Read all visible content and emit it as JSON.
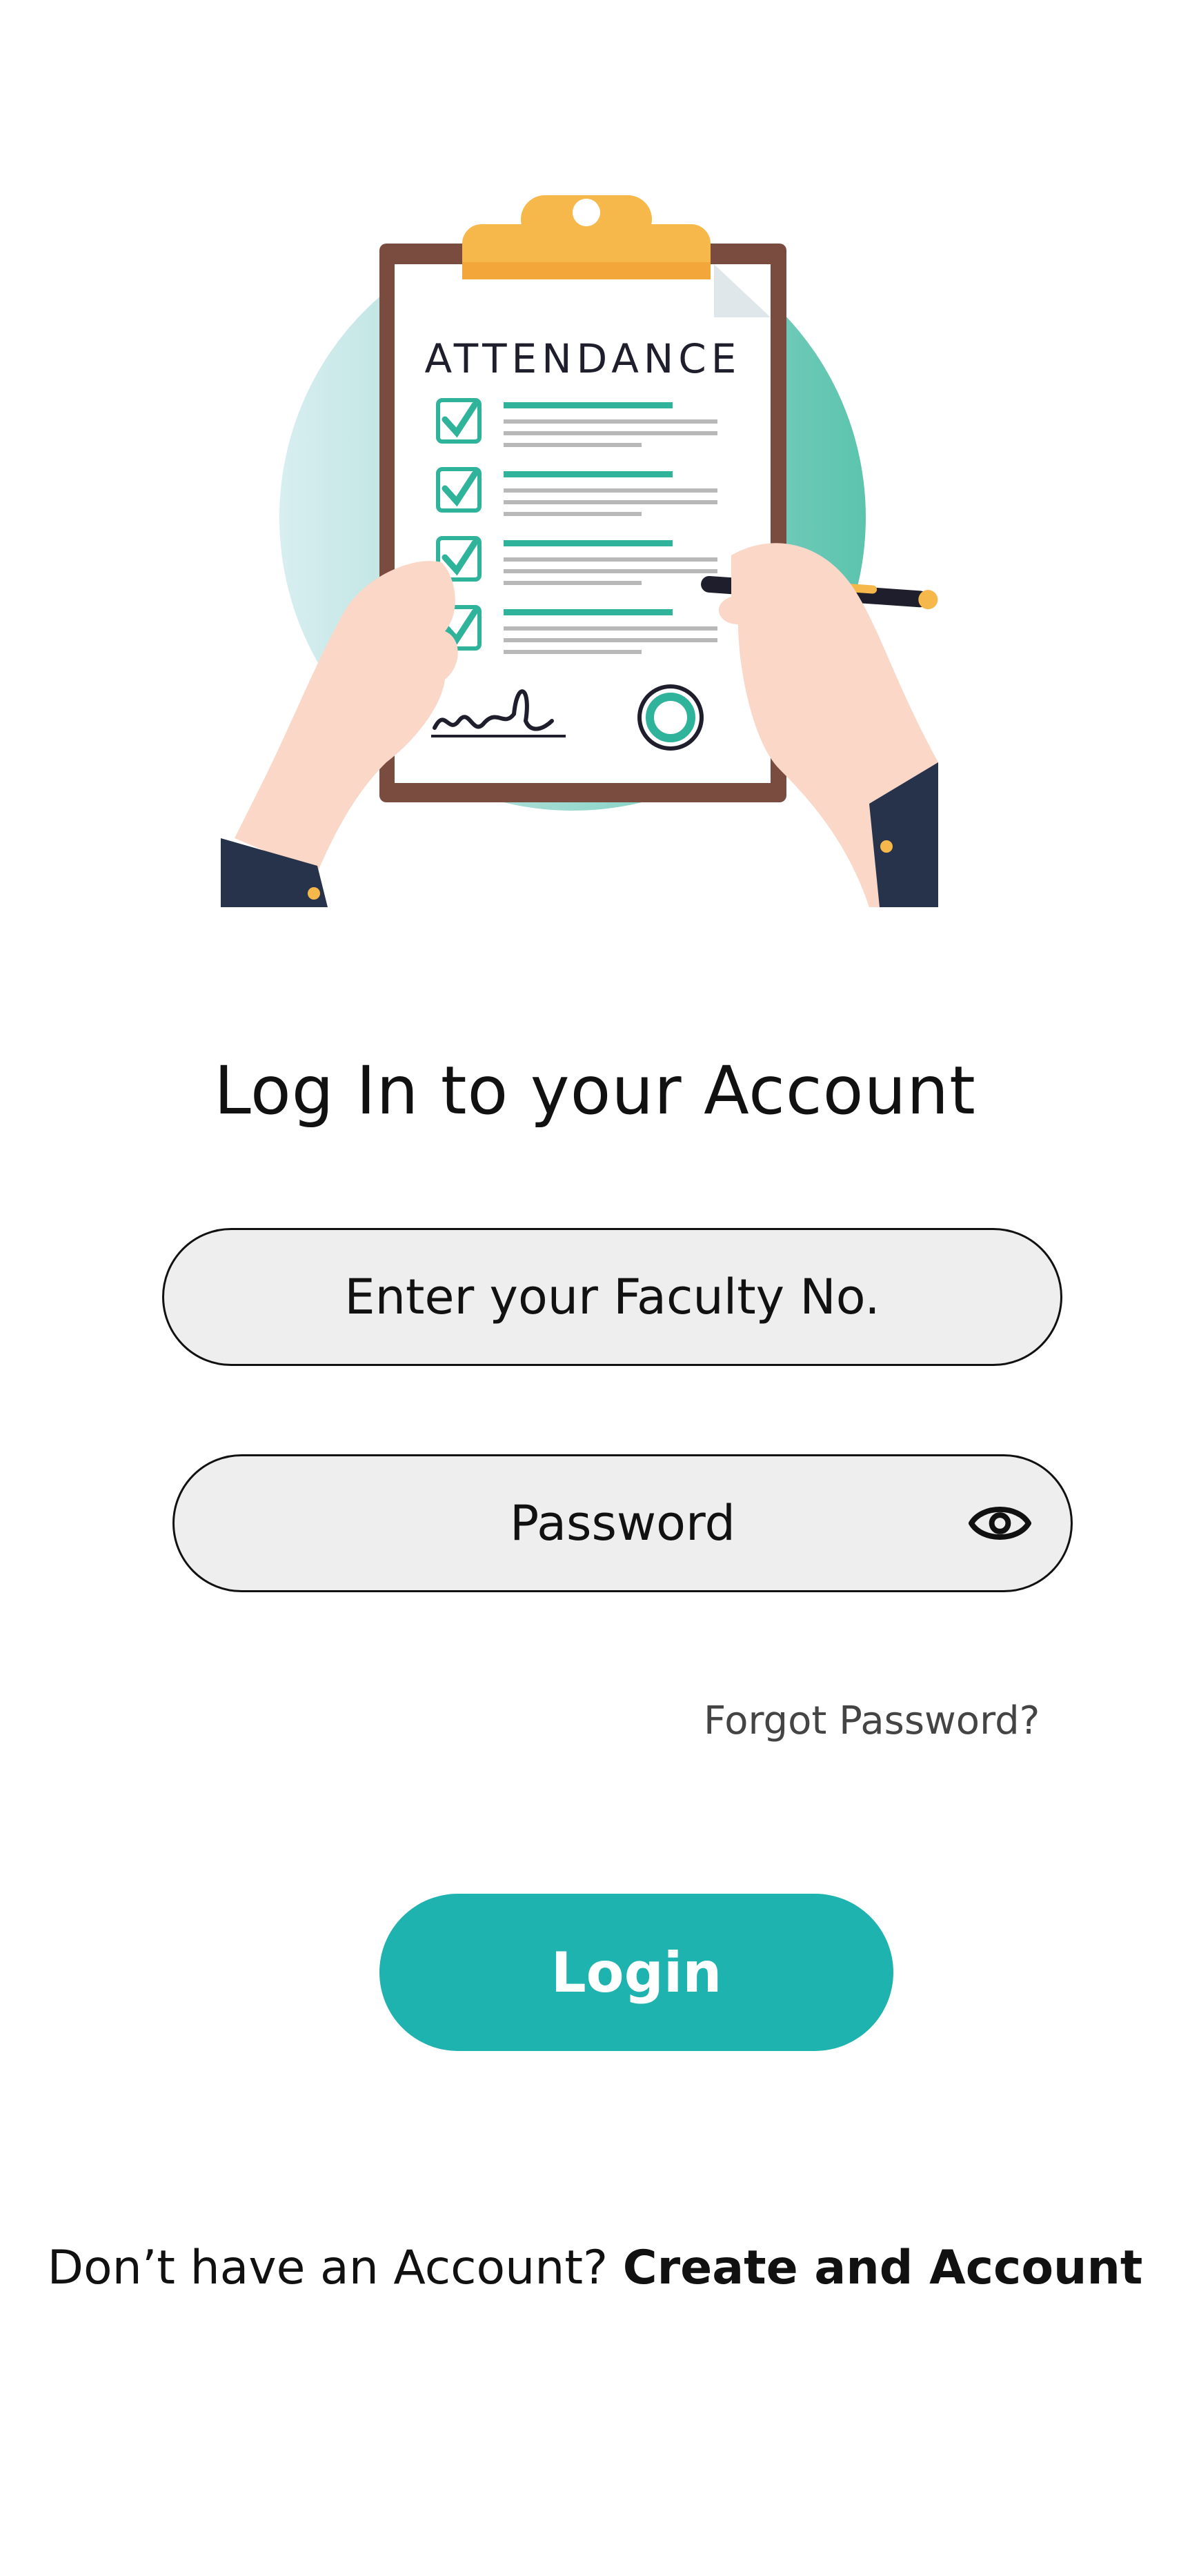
{
  "hero": {
    "clipboard_heading": "ATTENDANCE",
    "colors": {
      "teal": "#5dc3b3",
      "clip": "#f7b84b",
      "board": "#7a4b3f"
    }
  },
  "title": "Log In to your Account",
  "faculty_field": {
    "placeholder": "Enter your Faculty No.",
    "value": ""
  },
  "password_field": {
    "placeholder": "Password",
    "value": "",
    "toggle_icon": "eye-icon"
  },
  "forgot_password": "Forgot Password?",
  "login_button": "Login",
  "signup": {
    "prompt": "Don’t have an Account? ",
    "link": "Create and Account"
  },
  "accent_color": "#1fb3b0"
}
